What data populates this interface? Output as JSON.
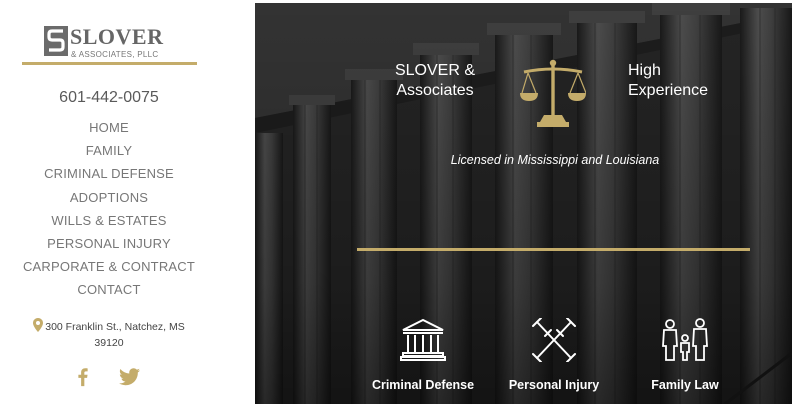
{
  "logo": {
    "name": "SLOVER",
    "sub": "& ASSOCIATES, PLLC"
  },
  "phone": "601-442-0075",
  "nav": [
    {
      "label": "HOME"
    },
    {
      "label": "FAMILY"
    },
    {
      "label": "CRIMINAL DEFENSE"
    },
    {
      "label": "ADOPTIONS"
    },
    {
      "label": "WILLS & ESTATES"
    },
    {
      "label": "PERSONAL INJURY"
    },
    {
      "label": "CARPORATE & CONTRACT"
    },
    {
      "label": "CONTACT"
    }
  ],
  "address": {
    "line1": "300 Franklin St., Natchez, MS",
    "line2": "39120"
  },
  "social": {
    "facebook_icon": "facebook-icon",
    "twitter_icon": "twitter-icon"
  },
  "hero": {
    "brand_left_1": "SLOVER &",
    "brand_left_2": "Associates",
    "brand_right_1": "High",
    "brand_right_2": "Experience",
    "tagline": "Licensed in Mississippi and Louisiana",
    "practices": [
      {
        "label": "Criminal Defense",
        "icon": "courthouse-icon"
      },
      {
        "label": "Personal Injury",
        "icon": "crutches-icon"
      },
      {
        "label": "Family Law",
        "icon": "family-icon"
      }
    ]
  },
  "colors": {
    "accent_gold": "#c4ac6a",
    "text_gray": "#777777",
    "hero_dark": "#2a2a2a"
  }
}
